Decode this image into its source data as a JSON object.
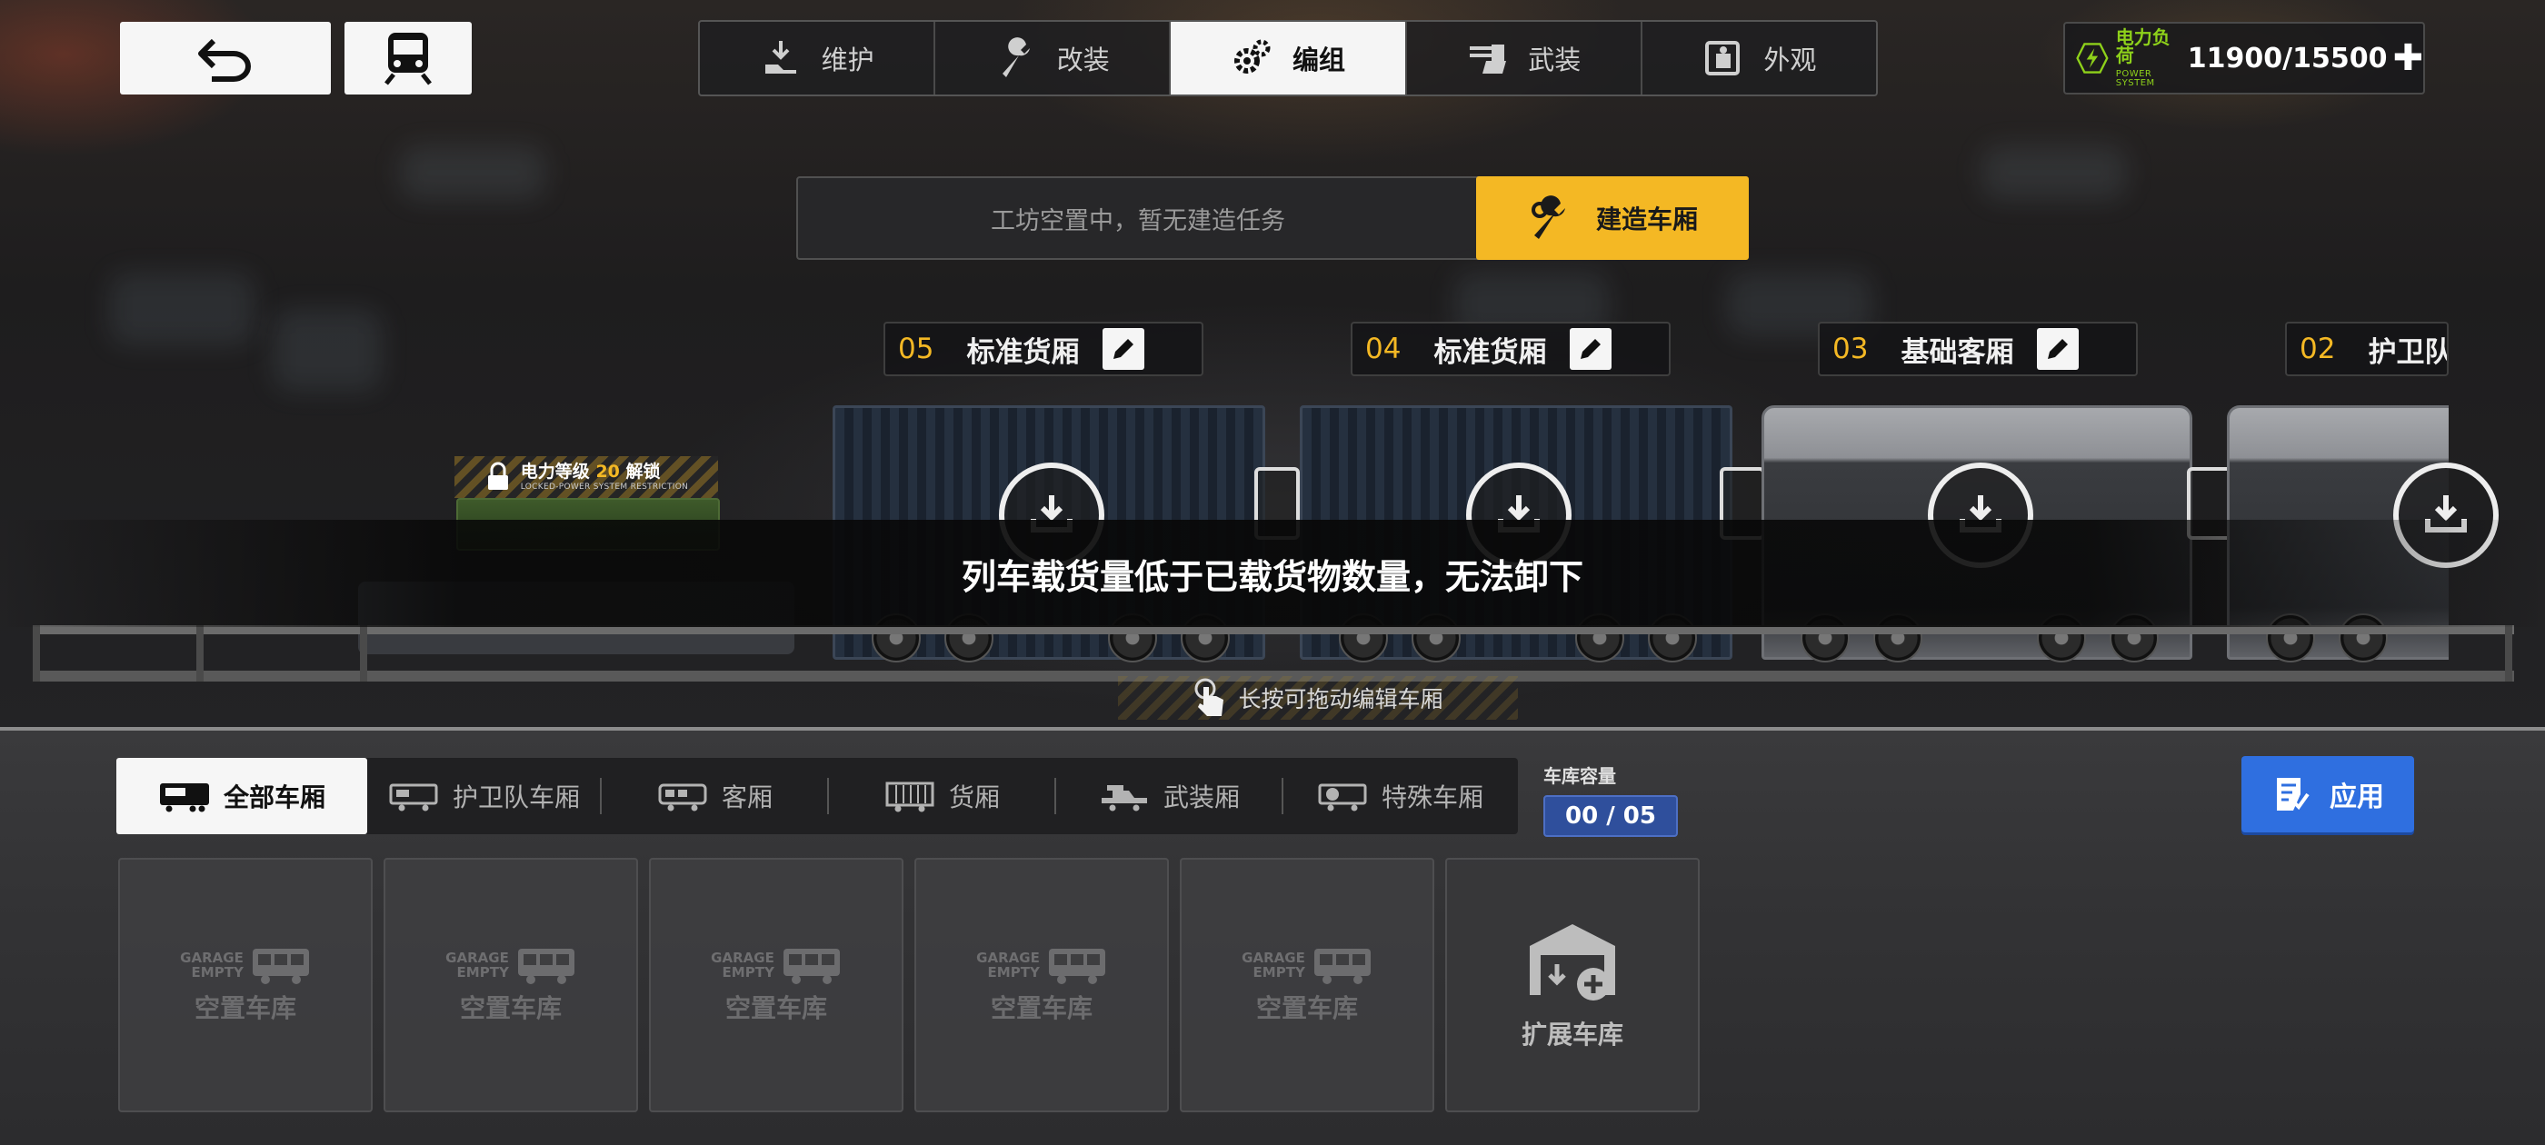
{
  "nav": {
    "back_icon": "undo-arrow-icon",
    "train_icon": "train-icon"
  },
  "tabs": [
    {
      "label": "维护",
      "icon": "maintenance-icon"
    },
    {
      "label": "改装",
      "icon": "wrench-icon"
    },
    {
      "label": "编组",
      "icon": "gears-icon",
      "active": true
    },
    {
      "label": "武装",
      "icon": "turret-icon"
    },
    {
      "label": "外观",
      "icon": "appearance-icon"
    }
  ],
  "power": {
    "label": "电力负荷",
    "sublabel": "POWER SYSTEM",
    "value": "11900/15500",
    "plus": "✚",
    "color": "#8ed11a"
  },
  "workshop": {
    "status": "工坊空置中，暂无建造任务",
    "build_label": "建造车厢",
    "accent": "#f4b824"
  },
  "locked_slot": {
    "prefix": "电力等级",
    "level": "20",
    "suffix": "解锁",
    "sub": "LOCKED-POWER SYSTEM RESTRICTION"
  },
  "cars": [
    {
      "number": "05",
      "name": "标准货厢"
    },
    {
      "number": "04",
      "name": "标准货厢"
    },
    {
      "number": "03",
      "name": "基础客厢"
    },
    {
      "number": "02",
      "name": "护卫队"
    }
  ],
  "toast": "列车载货量低于已载货物数量，无法卸下",
  "hint": "长按可拖动编辑车厢",
  "filters": [
    {
      "label": "全部车厢",
      "active": true
    },
    {
      "label": "护卫队车厢"
    },
    {
      "label": "客厢"
    },
    {
      "label": "货厢"
    },
    {
      "label": "武装厢"
    },
    {
      "label": "特殊车厢"
    }
  ],
  "capacity": {
    "label": "车库容量",
    "value": "00 / 05"
  },
  "apply_label": "应用",
  "garage": {
    "empty_tag_line1": "GARAGE",
    "empty_tag_line2": "EMPTY",
    "empty_label": "空置车库",
    "slots": [
      "空置车库",
      "空置车库",
      "空置车库",
      "空置车库",
      "空置车库"
    ],
    "expand_label": "扩展车库"
  }
}
